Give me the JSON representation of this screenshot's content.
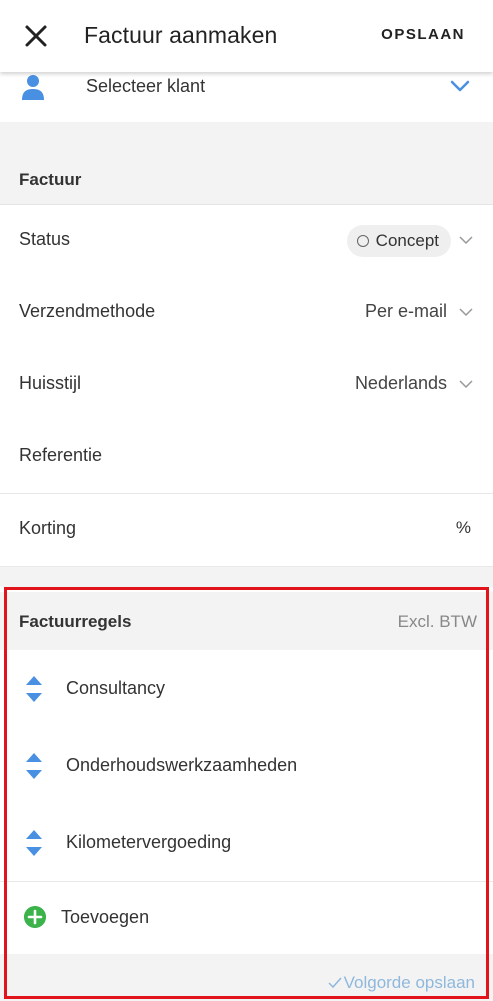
{
  "header": {
    "title": "Factuur aanmaken",
    "save_label": "OPSLAAN"
  },
  "client": {
    "placeholder": "Selecteer klant"
  },
  "invoice_section": {
    "title": "Factuur",
    "rows": {
      "status": {
        "label": "Status",
        "value": "Concept"
      },
      "shipping": {
        "label": "Verzendmethode",
        "value": "Per e-mail"
      },
      "style": {
        "label": "Huisstijl",
        "value": "Nederlands"
      },
      "reference": {
        "label": "Referentie"
      },
      "discount": {
        "label": "Korting",
        "suffix": "%"
      }
    }
  },
  "lines_section": {
    "title": "Factuurregels",
    "tax_note": "Excl. BTW",
    "lines": [
      {
        "label": "Consultancy"
      },
      {
        "label": "Onderhoudswerkzaamheden"
      },
      {
        "label": "Kilometervergoeding"
      }
    ],
    "add_label": "Toevoegen",
    "save_order_label": "Volgorde opslaan"
  },
  "colors": {
    "accent_blue": "#4a90e2",
    "add_green": "#3bb34a",
    "highlight_red": "#e1141b",
    "save_order_blue": "#8fb8dc"
  }
}
